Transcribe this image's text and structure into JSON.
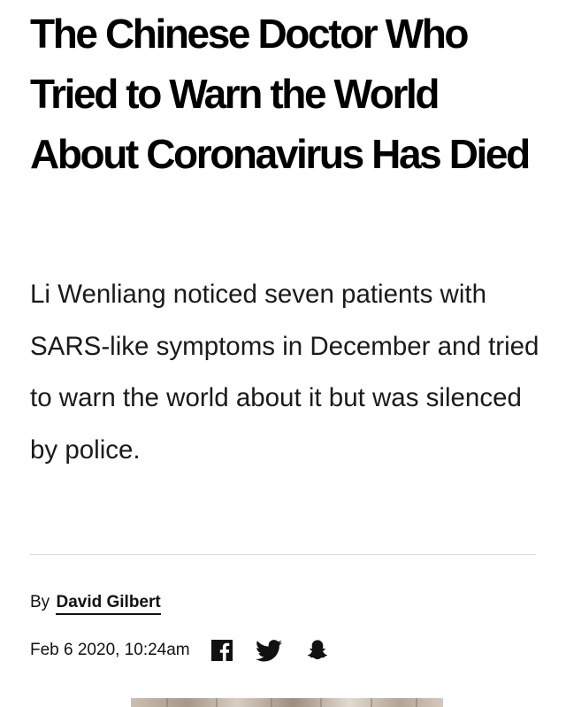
{
  "article": {
    "headline": "The Chinese Doctor Who Tried to Warn the World About Coronavirus Has Died",
    "dek": "Li Wenliang noticed seven patients with SARS-like symptoms in December and tried to warn the world about it but was silenced by police.",
    "byline": {
      "prefix": "By",
      "author": "David Gilbert"
    },
    "date": "Feb 6 2020, 10:24am",
    "share": [
      {
        "name": "facebook",
        "icon": "facebook-icon"
      },
      {
        "name": "twitter",
        "icon": "twitter-icon"
      },
      {
        "name": "snapchat",
        "icon": "snapchat-icon"
      }
    ]
  },
  "colors": {
    "text": "#111111",
    "divider": "#d9d9d9",
    "background": "#ffffff"
  }
}
